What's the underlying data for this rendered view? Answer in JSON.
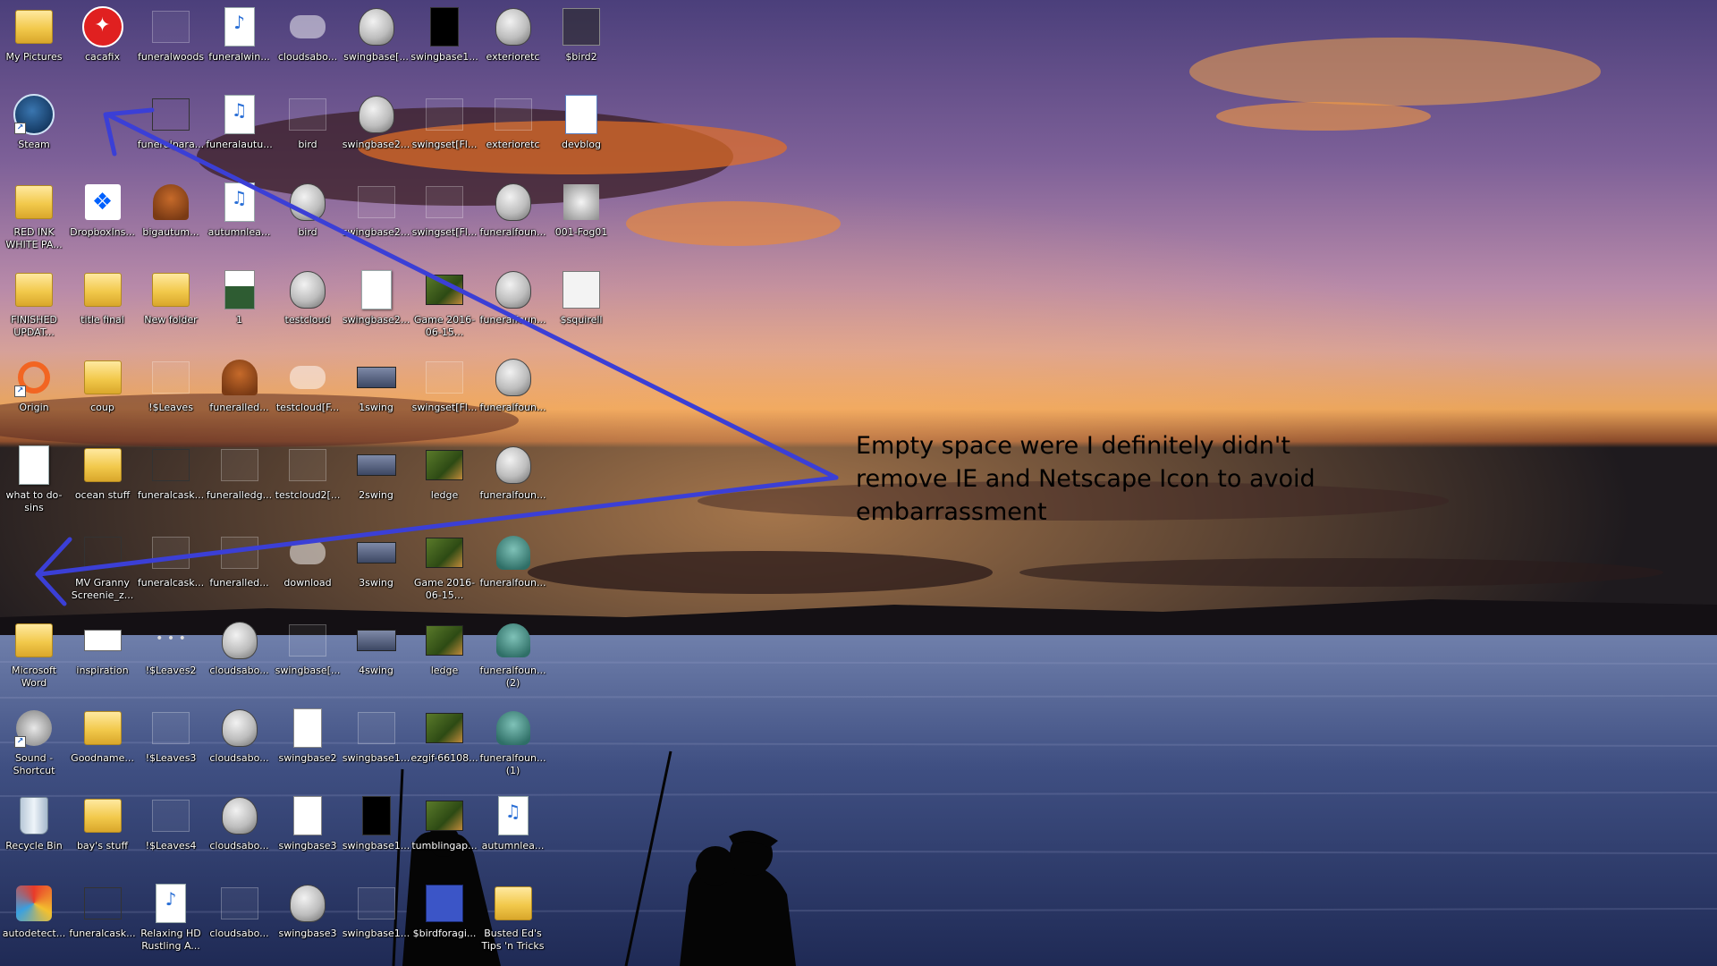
{
  "colors": {
    "sky_top": "#4a3f7a",
    "sky_mid": "#b085a8",
    "sunset_orange": "#e87f2c",
    "water": "#3c4d7f",
    "arrow": "#3b3fd6",
    "label_text": "#ffffff",
    "annotation_text": "#000000"
  },
  "annotation": {
    "text": "Empty space were I definitely didn't remove IE and Netscape Icon to avoid embarrassment"
  },
  "desktop_icons": [
    {
      "col": 0,
      "row": 0,
      "label": "My Pictures",
      "icon": "folder-icon",
      "glyph": "g-folder"
    },
    {
      "col": 1,
      "row": 0,
      "label": "cacafix",
      "icon": "cacafix-icon",
      "glyph": "g-cacafix",
      "sym": "✦"
    },
    {
      "col": 2,
      "row": 0,
      "label": "funeralwoods",
      "icon": "image-icon",
      "glyph": "g-faint"
    },
    {
      "col": 3,
      "row": 0,
      "label": "funeralwin...",
      "icon": "mp3-icon",
      "glyph": "g-mp3",
      "sym": "♪"
    },
    {
      "col": 4,
      "row": 0,
      "label": "cloudsabo...",
      "icon": "cloud-image-icon",
      "glyph": "g-cloud"
    },
    {
      "col": 5,
      "row": 0,
      "label": "swingbase[...",
      "icon": "gimp-icon",
      "glyph": "g-gimp"
    },
    {
      "col": 6,
      "row": 0,
      "label": "swingbase1...",
      "icon": "black-image-icon",
      "glyph": "g-black"
    },
    {
      "col": 7,
      "row": 0,
      "label": "exterioretc",
      "icon": "gimp-icon",
      "glyph": "g-gimp"
    },
    {
      "col": 8,
      "row": 0,
      "label": "$bird2",
      "icon": "sprite-sheet-icon",
      "glyph": "g-bird2"
    },
    {
      "col": 0,
      "row": 1,
      "label": "Steam",
      "icon": "steam-icon",
      "glyph": "g-steam",
      "shortcut": true
    },
    {
      "col": 2,
      "row": 1,
      "label": "funeralpara...",
      "icon": "image-icon",
      "glyph": "g-img"
    },
    {
      "col": 3,
      "row": 1,
      "label": "funeralautu...",
      "icon": "audio-file-icon",
      "glyph": "g-mp3",
      "sym": "♫"
    },
    {
      "col": 4,
      "row": 1,
      "label": "bird",
      "icon": "image-icon",
      "glyph": "g-faint"
    },
    {
      "col": 5,
      "row": 1,
      "label": "swingbase2...",
      "icon": "gimp-icon",
      "glyph": "g-gimp"
    },
    {
      "col": 6,
      "row": 1,
      "label": "swingset[Fl...",
      "icon": "swing-image-icon",
      "glyph": "g-faint"
    },
    {
      "col": 7,
      "row": 1,
      "label": "exterioretc",
      "icon": "image-icon",
      "glyph": "g-faint"
    },
    {
      "col": 8,
      "row": 1,
      "label": "devblog",
      "icon": "word-doc-icon",
      "glyph": "g-devblog"
    },
    {
      "col": 0,
      "row": 2,
      "label": "RED INK WHITE PA...",
      "icon": "folder-icon",
      "glyph": "g-folder"
    },
    {
      "col": 1,
      "row": 2,
      "label": "DropboxIns...",
      "icon": "dropbox-icon",
      "glyph": "g-dropbox",
      "sym": "❖"
    },
    {
      "col": 2,
      "row": 2,
      "label": "bigautum...",
      "icon": "tree-image-icon",
      "glyph": "g-tree"
    },
    {
      "col": 3,
      "row": 2,
      "label": "autumnlea...",
      "icon": "audio-file-icon",
      "glyph": "g-mp3",
      "sym": "♫"
    },
    {
      "col": 4,
      "row": 2,
      "label": "bird",
      "icon": "gimp-icon",
      "glyph": "g-gimp"
    },
    {
      "col": 5,
      "row": 2,
      "label": "swingbase2...",
      "icon": "swing-image-icon",
      "glyph": "g-faint"
    },
    {
      "col": 6,
      "row": 2,
      "label": "swingset[Fl...",
      "icon": "swing-image-icon",
      "glyph": "g-faint"
    },
    {
      "col": 7,
      "row": 2,
      "label": "funeralfoun...",
      "icon": "gimp-icon",
      "glyph": "g-gimp"
    },
    {
      "col": 8,
      "row": 2,
      "label": "001-Fog01",
      "icon": "fog-image-icon",
      "glyph": "g-fog"
    },
    {
      "col": 0,
      "row": 3,
      "label": "FINISHED UPDAT...",
      "icon": "folder-icon",
      "glyph": "g-folder"
    },
    {
      "col": 1,
      "row": 3,
      "label": "title final",
      "icon": "folder-icon",
      "glyph": "g-folder"
    },
    {
      "col": 2,
      "row": 3,
      "label": "New folder",
      "icon": "folder-icon",
      "glyph": "g-folder"
    },
    {
      "col": 3,
      "row": 3,
      "label": "1",
      "icon": "image-icon",
      "glyph": "g-page1"
    },
    {
      "col": 4,
      "row": 3,
      "label": "testcloud",
      "icon": "gimp-icon",
      "glyph": "g-gimp"
    },
    {
      "col": 5,
      "row": 3,
      "label": "swingbase2...",
      "icon": "document-icon",
      "glyph": "g-doc"
    },
    {
      "col": 6,
      "row": 3,
      "label": "Game 2016-06-15...",
      "icon": "video-icon",
      "glyph": "g-gif"
    },
    {
      "col": 7,
      "row": 3,
      "label": "funeralfoun...",
      "icon": "gimp-icon",
      "glyph": "g-gimp"
    },
    {
      "col": 8,
      "row": 3,
      "label": "$squirell",
      "icon": "sprite-sheet-icon",
      "glyph": "g-squirrel"
    },
    {
      "col": 0,
      "row": 4,
      "label": "Origin",
      "icon": "origin-icon",
      "glyph": "g-origin",
      "shortcut": true
    },
    {
      "col": 1,
      "row": 4,
      "label": "coup",
      "icon": "folder-icon",
      "glyph": "g-folder"
    },
    {
      "col": 2,
      "row": 4,
      "label": "!$Leaves",
      "icon": "image-icon",
      "glyph": "g-faint"
    },
    {
      "col": 3,
      "row": 4,
      "label": "funeralled...",
      "icon": "image-icon",
      "glyph": "g-tree"
    },
    {
      "col": 4,
      "row": 4,
      "label": "testcloud[F...",
      "icon": "cloud-image-icon",
      "glyph": "g-cloud"
    },
    {
      "col": 5,
      "row": 4,
      "label": "1swing",
      "icon": "swing-image-icon",
      "glyph": "g-swingbar"
    },
    {
      "col": 6,
      "row": 4,
      "label": "swingset[Fl...",
      "icon": "swing-image-icon",
      "glyph": "g-faint"
    },
    {
      "col": 7,
      "row": 4,
      "label": "funeralfoun...",
      "icon": "gimp-icon",
      "glyph": "g-gimp"
    },
    {
      "col": 0,
      "row": 5,
      "label": "what to do-sins",
      "icon": "text-file-icon",
      "glyph": "g-doc"
    },
    {
      "col": 1,
      "row": 5,
      "label": "ocean stuff",
      "icon": "folder-icon",
      "glyph": "g-folder"
    },
    {
      "col": 2,
      "row": 5,
      "label": "funeralcask...",
      "icon": "image-icon",
      "glyph": "g-img"
    },
    {
      "col": 3,
      "row": 5,
      "label": "funeralledg...",
      "icon": "image-icon",
      "glyph": "g-faint"
    },
    {
      "col": 4,
      "row": 5,
      "label": "testcloud2[...",
      "icon": "cloud-image-icon",
      "glyph": "g-faint"
    },
    {
      "col": 5,
      "row": 5,
      "label": "2swing",
      "icon": "swing-image-icon",
      "glyph": "g-swingbar"
    },
    {
      "col": 6,
      "row": 5,
      "label": "ledge",
      "icon": "video-icon",
      "glyph": "g-gif"
    },
    {
      "col": 7,
      "row": 5,
      "label": "funeralfoun...",
      "icon": "gimp-icon",
      "glyph": "g-gimp"
    },
    {
      "col": 1,
      "row": 6,
      "label": "MV Granny Screenie_z...",
      "icon": "image-icon",
      "glyph": "g-img"
    },
    {
      "col": 2,
      "row": 6,
      "label": "funeralcask...",
      "icon": "image-icon",
      "glyph": "g-faint"
    },
    {
      "col": 3,
      "row": 6,
      "label": "funeralled...",
      "icon": "image-icon",
      "glyph": "g-faint"
    },
    {
      "col": 4,
      "row": 6,
      "label": "download",
      "icon": "image-icon",
      "glyph": "g-cloud"
    },
    {
      "col": 5,
      "row": 6,
      "label": "3swing",
      "icon": "swing-image-icon",
      "glyph": "g-swingbar"
    },
    {
      "col": 6,
      "row": 6,
      "label": "Game 2016-06-15...",
      "icon": "video-icon",
      "glyph": "g-gif"
    },
    {
      "col": 7,
      "row": 6,
      "label": "funeralfoun...",
      "icon": "fountain-icon",
      "glyph": "g-fountain"
    },
    {
      "col": 0,
      "row": 7,
      "label": "Microsoft Word",
      "icon": "folder-icon",
      "glyph": "g-folder"
    },
    {
      "col": 1,
      "row": 7,
      "label": "inspiration",
      "icon": "image-icon",
      "glyph": "g-inspiration"
    },
    {
      "col": 2,
      "row": 7,
      "label": "!$Leaves2",
      "icon": "image-icon",
      "glyph": "g-dots",
      "sym": "• • •"
    },
    {
      "col": 3,
      "row": 7,
      "label": "cloudsabo...",
      "icon": "gimp-icon",
      "glyph": "g-gimp"
    },
    {
      "col": 4,
      "row": 7,
      "label": "swingbase[...",
      "icon": "swing-image-icon",
      "glyph": "g-faint"
    },
    {
      "col": 5,
      "row": 7,
      "label": "4swing",
      "icon": "swing-image-icon",
      "glyph": "g-swingbar"
    },
    {
      "col": 6,
      "row": 7,
      "label": "ledge",
      "icon": "video-icon",
      "glyph": "g-gif"
    },
    {
      "col": 7,
      "row": 7,
      "label": "funeralfoun... (2)",
      "icon": "fountain-icon",
      "glyph": "g-fountain"
    },
    {
      "col": 0,
      "row": 8,
      "label": "Sound - Shortcut",
      "icon": "sound-icon",
      "glyph": "g-sound",
      "shortcut": true
    },
    {
      "col": 1,
      "row": 8,
      "label": "Goodname...",
      "icon": "folder-icon",
      "glyph": "g-folder"
    },
    {
      "col": 2,
      "row": 8,
      "label": "!$Leaves3",
      "icon": "image-icon",
      "glyph": "g-faint"
    },
    {
      "col": 3,
      "row": 8,
      "label": "cloudsabo...",
      "icon": "gimp-icon",
      "glyph": "g-gimp"
    },
    {
      "col": 4,
      "row": 8,
      "label": "swingbase2",
      "icon": "swing-image-icon",
      "glyph": "g-swing"
    },
    {
      "col": 5,
      "row": 8,
      "label": "swingbase1...",
      "icon": "swing-image-icon",
      "glyph": "g-faint"
    },
    {
      "col": 6,
      "row": 8,
      "label": "ezgif-66108...",
      "icon": "video-icon",
      "glyph": "g-gif"
    },
    {
      "col": 7,
      "row": 8,
      "label": "funeralfoun... (1)",
      "icon": "fountain-icon",
      "glyph": "g-fountain"
    },
    {
      "col": 0,
      "row": 9,
      "label": "Recycle Bin",
      "icon": "recycle-bin-icon",
      "glyph": "g-bin"
    },
    {
      "col": 1,
      "row": 9,
      "label": "bay's stuff",
      "icon": "folder-icon",
      "glyph": "g-folder"
    },
    {
      "col": 2,
      "row": 9,
      "label": "!$Leaves4",
      "icon": "image-icon",
      "glyph": "g-faint"
    },
    {
      "col": 3,
      "row": 9,
      "label": "cloudsabo...",
      "icon": "gimp-icon",
      "glyph": "g-gimp"
    },
    {
      "col": 4,
      "row": 9,
      "label": "swingbase3",
      "icon": "swing-image-icon",
      "glyph": "g-swing"
    },
    {
      "col": 5,
      "row": 9,
      "label": "swingbase1...",
      "icon": "black-image-icon",
      "glyph": "g-black"
    },
    {
      "col": 6,
      "row": 9,
      "label": "tumblingap...",
      "icon": "video-icon",
      "glyph": "g-gif"
    },
    {
      "col": 7,
      "row": 9,
      "label": "autumnlea...",
      "icon": "audio-file-icon",
      "glyph": "g-mp3",
      "sym": "♫"
    },
    {
      "col": 0,
      "row": 10,
      "label": "autodetect...",
      "icon": "autodetect-icon",
      "glyph": "g-autodetect"
    },
    {
      "col": 1,
      "row": 10,
      "label": "funeralcask...",
      "icon": "image-icon",
      "glyph": "g-img"
    },
    {
      "col": 2,
      "row": 10,
      "label": "Relaxing HD Rustling A...",
      "icon": "mp3-icon",
      "glyph": "g-mp3",
      "sym": "♪"
    },
    {
      "col": 3,
      "row": 10,
      "label": "cloudsabo...",
      "icon": "image-icon",
      "glyph": "g-faint"
    },
    {
      "col": 4,
      "row": 10,
      "label": "swingbase3",
      "icon": "gimp-icon",
      "glyph": "g-gimp"
    },
    {
      "col": 5,
      "row": 10,
      "label": "swingbase1...",
      "icon": "swing-image-icon",
      "glyph": "g-faint"
    },
    {
      "col": 6,
      "row": 10,
      "label": "$birdforagi...",
      "icon": "sprite-sheet-icon",
      "glyph": "g-birdforage"
    },
    {
      "col": 7,
      "row": 10,
      "label": "Busted Ed's Tips 'n Tricks",
      "icon": "folder-icon",
      "glyph": "g-folder"
    }
  ]
}
